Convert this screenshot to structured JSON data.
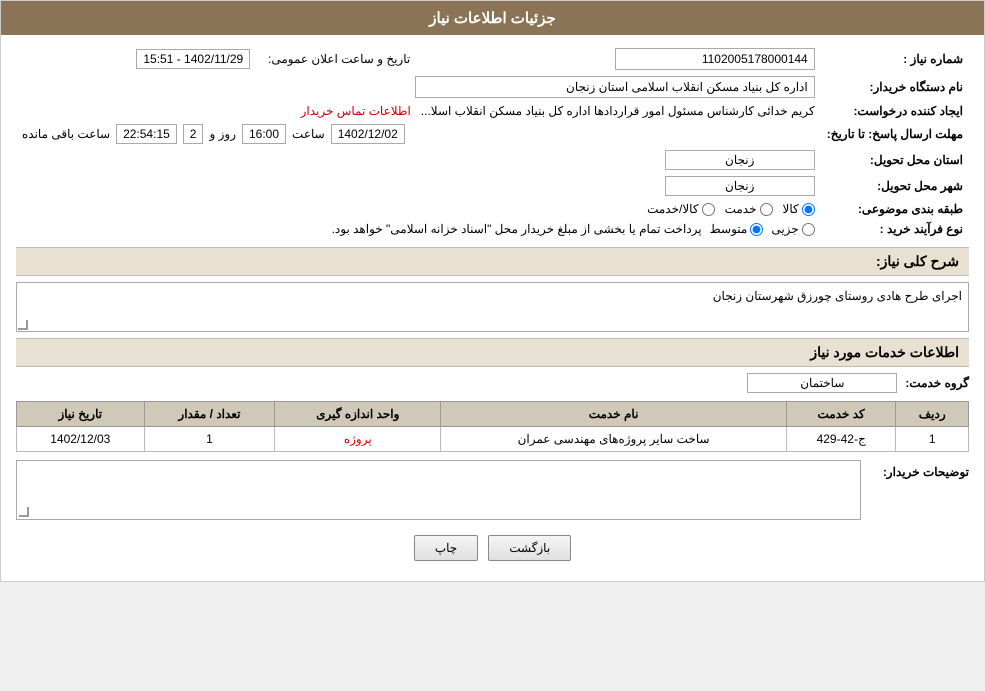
{
  "header": {
    "title": "جزئیات اطلاعات نیاز"
  },
  "fields": {
    "need_number_label": "شماره نیاز :",
    "need_number_value": "1102005178000144",
    "announce_date_label": "تاریخ و ساعت اعلان عمومی:",
    "announce_date_value": "1402/11/29 - 15:51",
    "buyer_org_label": "نام دستگاه خریدار:",
    "buyer_org_value": "اداره کل بنیاد مسکن انقلاب اسلامی استان زنجان",
    "creator_label": "ایجاد کننده درخواست:",
    "creator_value": "کریم خدائی کارشناس مسئول امور قراردادها اداره کل بنیاد مسکن انقلاب اسلا...",
    "contact_link": "اطلاعات تماس خریدار",
    "response_deadline_label": "مهلت ارسال پاسخ: تا تاریخ:",
    "response_date": "1402/12/02",
    "response_time_label": "ساعت",
    "response_time": "16:00",
    "response_days_label": "روز و",
    "response_days": "2",
    "response_remaining_label": "ساعت باقی مانده",
    "response_remaining": "22:54:15",
    "delivery_province_label": "استان محل تحویل:",
    "delivery_province_value": "زنجان",
    "delivery_city_label": "شهر محل تحویل:",
    "delivery_city_value": "زنجان",
    "category_label": "طبقه بندی موضوعی:",
    "category_options": [
      "کالا",
      "خدمت",
      "کالا/خدمت"
    ],
    "category_selected": "کالا",
    "purchase_type_label": "نوع فرآیند خرید :",
    "purchase_type_options": [
      "جزیی",
      "متوسط"
    ],
    "purchase_type_selected": "متوسط",
    "purchase_type_note": "پرداخت تمام یا بخشی از مبلغ خریدار محل \"اسناد خزانه اسلامی\" خواهد بود.",
    "description_section": "شرح کلی نیاز:",
    "description_value": "اجرای طرح هادی روستای چورزق شهرستان زنجان",
    "services_section": "اطلاعات خدمات مورد نیاز",
    "service_group_label": "گروه خدمت:",
    "service_group_value": "ساختمان",
    "table_headers": [
      "ردیف",
      "کد خدمت",
      "نام خدمت",
      "واحد اندازه گیری",
      "تعداد / مقدار",
      "تاریخ نیاز"
    ],
    "table_rows": [
      {
        "row": "1",
        "code": "ج-42-429",
        "name": "ساخت سایر پروژه‌های مهندسی عمران",
        "unit": "پروژه",
        "qty": "1",
        "date": "1402/12/03"
      }
    ],
    "buyer_notes_label": "توضیحات خریدار:",
    "back_btn": "بازگشت",
    "print_btn": "چاپ"
  }
}
